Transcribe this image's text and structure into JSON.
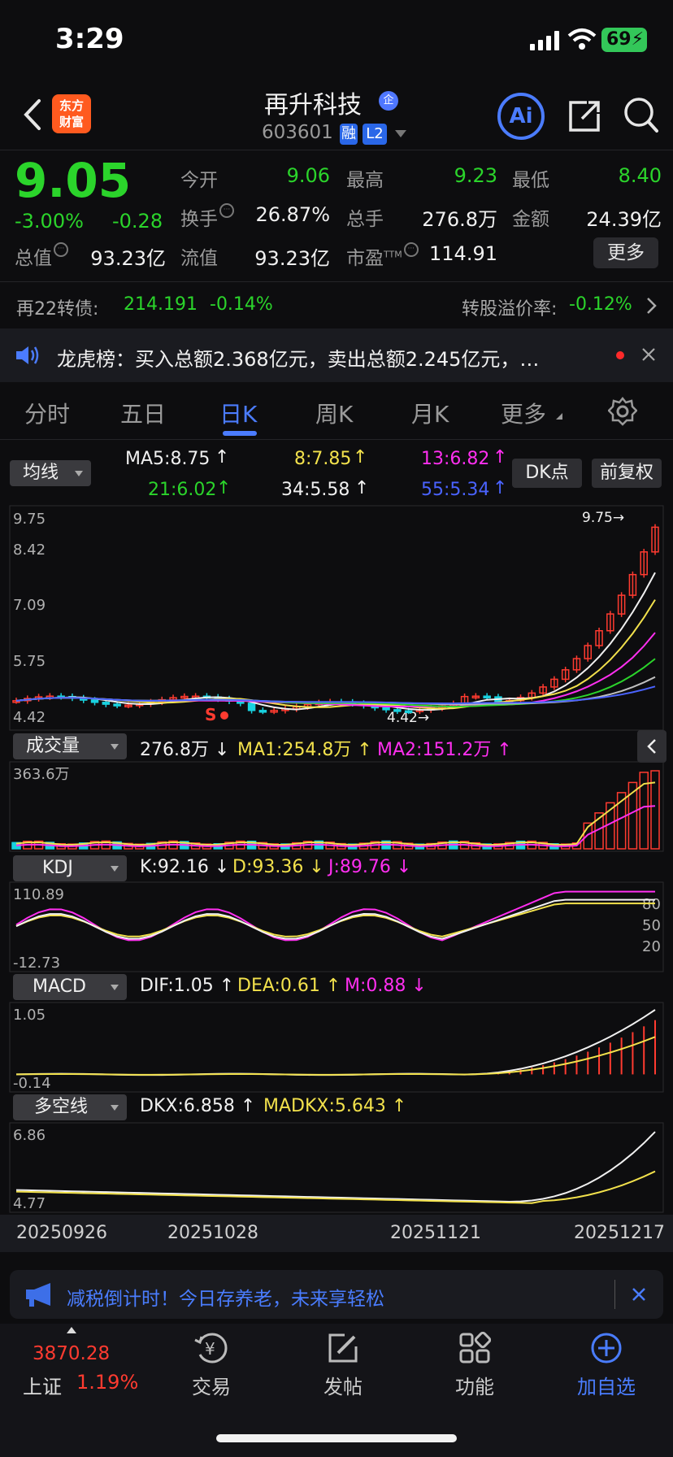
{
  "status": {
    "time": "3:29",
    "battery": "69"
  },
  "header": {
    "logo_line1": "东方",
    "logo_line2": "财富",
    "stock_name": "再升科技",
    "name_badge": "企",
    "stock_code": "603601",
    "tag_rong": "融",
    "tag_l2": "L2",
    "ai_label": "Ai"
  },
  "quote": {
    "price": "9.05",
    "change_pct": "-3.00%",
    "change_val": "-0.28",
    "open_label": "今开",
    "open_value": "9.06",
    "high_label": "最高",
    "high_value": "9.23",
    "low_label": "最低",
    "low_value": "8.40",
    "turnover_label": "换手",
    "turnover_value": "26.87%",
    "volume_label": "总手",
    "volume_value": "276.8万",
    "amount_label": "金额",
    "amount_value": "24.39亿",
    "mktcap_label": "总值",
    "mktcap_value": "93.23亿",
    "float_label": "流值",
    "float_value": "93.23亿",
    "pe_label": "市盈",
    "pe_sup": "TTM",
    "pe_value": "114.91",
    "more_label": "更多"
  },
  "bond": {
    "label": "再22转债:",
    "price": "214.191",
    "change": "-0.14%",
    "premium_label": "转股溢价率:",
    "premium_value": "-0.12%"
  },
  "notice": {
    "text": "龙虎榜：买入总额2.368亿元，卖出总额2.245亿元，…"
  },
  "tabs": [
    {
      "label": "分时"
    },
    {
      "label": "五日"
    },
    {
      "label": "日K"
    },
    {
      "label": "周K"
    },
    {
      "label": "月K"
    },
    {
      "label": "更多"
    }
  ],
  "ma_panel": {
    "select": "均线",
    "ma5": "MA5:8.75",
    "ma8": "8:7.85",
    "ma13": "13:6.82",
    "ma21": "21:6.02",
    "ma34": "34:5.58",
    "ma55": "55:5.34",
    "dk_btn": "DK点",
    "fq_btn": "前复权",
    "colors": {
      "ma5": "#f0f0f0",
      "ma8": "#f2e14c",
      "ma13": "#ff2ff0",
      "ma21": "#2bd42b",
      "ma34": "#bfbfbf",
      "ma55": "#4a63ff"
    }
  },
  "kline": {
    "y_labels": [
      "9.75",
      "8.42",
      "7.09",
      "5.75",
      "4.42"
    ],
    "high_mark": "9.75→",
    "low_mark": "4.42→",
    "s_mark": "S"
  },
  "volume": {
    "select": "成交量",
    "vol": "276.8万",
    "ma1": "MA1:254.8万",
    "ma2": "MA2:151.2万",
    "max_label": "363.6万"
  },
  "kdj": {
    "select": "KDJ",
    "k": "K:92.16",
    "d": "D:93.36",
    "j": "J:89.76",
    "top": "110.89",
    "bottom": "-12.73",
    "levels": [
      "80",
      "50",
      "20"
    ]
  },
  "macd": {
    "select": "MACD",
    "dif": "DIF:1.05",
    "dea": "DEA:0.61",
    "m": "M:0.88",
    "top": "1.05",
    "bottom": "-0.14"
  },
  "dkx": {
    "select": "多空线",
    "dkx": "DKX:6.858",
    "madkx": "MADKX:5.643",
    "top": "6.86",
    "bottom": "4.77"
  },
  "dates": [
    "20250926",
    "20251028",
    "20251121",
    "20251217"
  ],
  "promo": {
    "text": "减税倒计时！今日存养老，未来享轻松"
  },
  "tabbar": {
    "index_value": "3870.28",
    "index_name": "上证",
    "index_change": "1.19%",
    "trade": "交易",
    "post": "发帖",
    "features": "功能",
    "add": "加自选"
  }
}
